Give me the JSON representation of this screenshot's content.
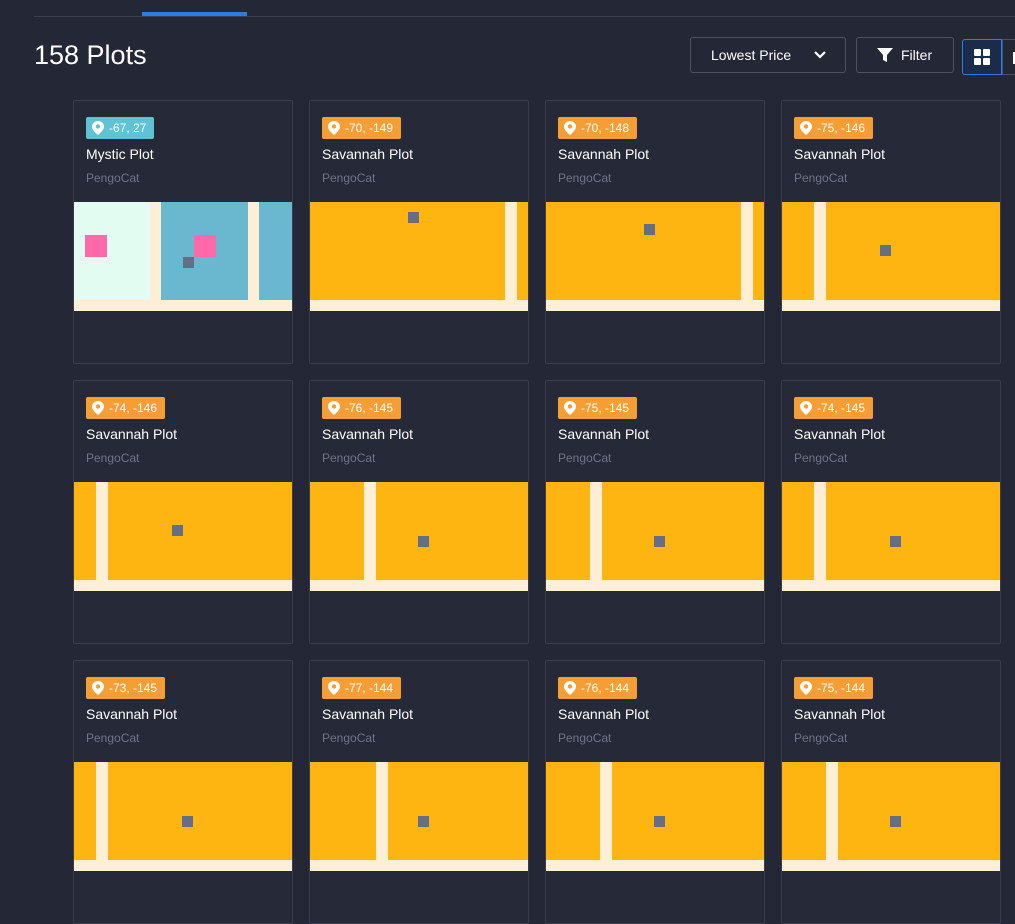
{
  "header": {
    "title": "158 Plots",
    "sort_label": "Lowest Price",
    "filter_label": "Filter",
    "icons": {
      "sort": "chevron-down-icon",
      "filter": "filter-icon",
      "grid": "grid-view-icon",
      "list": "list-view-icon",
      "location": "location-pin-icon"
    }
  },
  "colors": {
    "background": "#242735",
    "accent": "#2d7be5",
    "badge_orange": "#f59e35",
    "badge_teal": "#5fc3d3",
    "savannah": "#ffb511",
    "road": "#fdefd6",
    "mystic_light": "#e3fcf2",
    "mystic_water": "#6ab8cf",
    "pink": "#ff69a8",
    "marker": "#646e86"
  },
  "plots": [
    {
      "coords": "-67, 27",
      "name": "Mystic Plot",
      "owner": "PengoCat",
      "type": "mystic"
    },
    {
      "coords": "-70, -149",
      "name": "Savannah Plot",
      "owner": "PengoCat",
      "type": "savannah"
    },
    {
      "coords": "-70, -148",
      "name": "Savannah Plot",
      "owner": "PengoCat",
      "type": "savannah"
    },
    {
      "coords": "-75, -146",
      "name": "Savannah Plot",
      "owner": "PengoCat",
      "type": "savannah"
    },
    {
      "coords": "-74, -146",
      "name": "Savannah Plot",
      "owner": "PengoCat",
      "type": "savannah"
    },
    {
      "coords": "-76, -145",
      "name": "Savannah Plot",
      "owner": "PengoCat",
      "type": "savannah"
    },
    {
      "coords": "-75, -145",
      "name": "Savannah Plot",
      "owner": "PengoCat",
      "type": "savannah"
    },
    {
      "coords": "-74, -145",
      "name": "Savannah Plot",
      "owner": "PengoCat",
      "type": "savannah"
    },
    {
      "coords": "-73, -145",
      "name": "Savannah Plot",
      "owner": "PengoCat",
      "type": "savannah"
    },
    {
      "coords": "-77, -144",
      "name": "Savannah Plot",
      "owner": "PengoCat",
      "type": "savannah"
    },
    {
      "coords": "-76, -144",
      "name": "Savannah Plot",
      "owner": "PengoCat",
      "type": "savannah"
    },
    {
      "coords": "-75, -144",
      "name": "Savannah Plot",
      "owner": "PengoCat",
      "type": "savannah"
    }
  ]
}
